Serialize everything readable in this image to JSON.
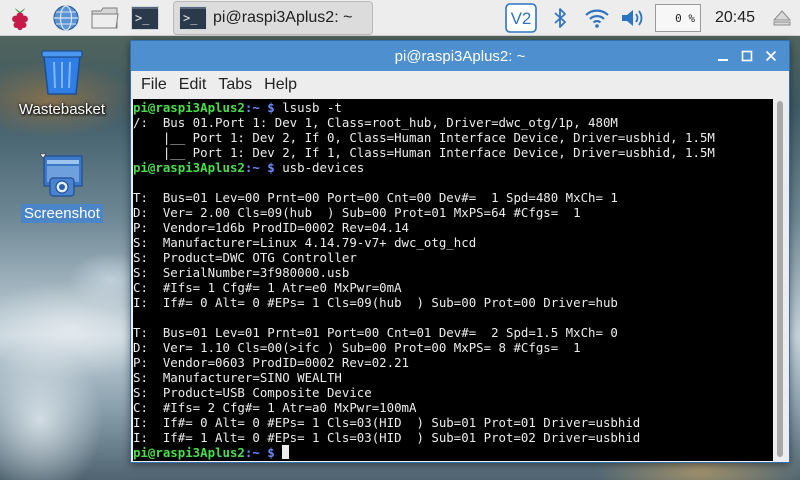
{
  "panel": {
    "launchers": [
      {
        "icon": "raspberry-menu-icon"
      },
      {
        "icon": "web-browser-icon"
      },
      {
        "icon": "file-manager-icon"
      },
      {
        "icon": "terminal-icon",
        "glyph": ">_"
      }
    ],
    "task": {
      "icon": "terminal-icon",
      "glyph": ">_",
      "label": "pi@raspi3Aplus2: ~"
    },
    "tray": {
      "vnc_label": "V2",
      "cpu_usage": "0 %",
      "clock": "20:45"
    }
  },
  "desktop": {
    "icons": [
      {
        "label": "Wastebasket",
        "icon": "wastebasket-icon"
      },
      {
        "label": "Screenshot",
        "icon": "screenshot-icon"
      }
    ]
  },
  "window": {
    "title": "pi@raspi3Aplus2: ~",
    "menu": [
      "File",
      "Edit",
      "Tabs",
      "Help"
    ]
  },
  "terminal": {
    "prompt_user": "pi@raspi3Aplus2",
    "prompt_path": ":~ $",
    "lines": [
      {
        "type": "prompt",
        "cmd": " lsusb -t"
      },
      {
        "type": "out",
        "text": "/:  Bus 01.Port 1: Dev 1, Class=root_hub, Driver=dwc_otg/1p, 480M"
      },
      {
        "type": "out",
        "text": "    |__ Port 1: Dev 2, If 0, Class=Human Interface Device, Driver=usbhid, 1.5M"
      },
      {
        "type": "out",
        "text": "    |__ Port 1: Dev 2, If 1, Class=Human Interface Device, Driver=usbhid, 1.5M"
      },
      {
        "type": "prompt",
        "cmd": " usb-devices"
      },
      {
        "type": "out",
        "text": ""
      },
      {
        "type": "out",
        "text": "T:  Bus=01 Lev=00 Prnt=00 Port=00 Cnt=00 Dev#=  1 Spd=480 MxCh= 1"
      },
      {
        "type": "out",
        "text": "D:  Ver= 2.00 Cls=09(hub  ) Sub=00 Prot=01 MxPS=64 #Cfgs=  1"
      },
      {
        "type": "out",
        "text": "P:  Vendor=1d6b ProdID=0002 Rev=04.14"
      },
      {
        "type": "out",
        "text": "S:  Manufacturer=Linux 4.14.79-v7+ dwc_otg_hcd"
      },
      {
        "type": "out",
        "text": "S:  Product=DWC OTG Controller"
      },
      {
        "type": "out",
        "text": "S:  SerialNumber=3f980000.usb"
      },
      {
        "type": "out",
        "text": "C:  #Ifs= 1 Cfg#= 1 Atr=e0 MxPwr=0mA"
      },
      {
        "type": "out",
        "text": "I:  If#= 0 Alt= 0 #EPs= 1 Cls=09(hub  ) Sub=00 Prot=00 Driver=hub"
      },
      {
        "type": "out",
        "text": ""
      },
      {
        "type": "out",
        "text": "T:  Bus=01 Lev=01 Prnt=01 Port=00 Cnt=01 Dev#=  2 Spd=1.5 MxCh= 0"
      },
      {
        "type": "out",
        "text": "D:  Ver= 1.10 Cls=00(>ifc ) Sub=00 Prot=00 MxPS= 8 #Cfgs=  1"
      },
      {
        "type": "out",
        "text": "P:  Vendor=0603 ProdID=0002 Rev=02.21"
      },
      {
        "type": "out",
        "text": "S:  Manufacturer=SINO WEALTH"
      },
      {
        "type": "out",
        "text": "S:  Product=USB Composite Device"
      },
      {
        "type": "out",
        "text": "C:  #Ifs= 2 Cfg#= 1 Atr=a0 MxPwr=100mA"
      },
      {
        "type": "out",
        "text": "I:  If#= 0 Alt= 0 #EPs= 1 Cls=03(HID  ) Sub=01 Prot=01 Driver=usbhid"
      },
      {
        "type": "out",
        "text": "I:  If#= 1 Alt= 0 #EPs= 1 Cls=03(HID  ) Sub=01 Prot=02 Driver=usbhid"
      },
      {
        "type": "prompt",
        "cmd": " ",
        "cursor": true
      }
    ]
  },
  "colors": {
    "titlebar": "#4d8fcf",
    "prompt_user": "#4ade4a",
    "prompt_path": "#6a8bff",
    "terminal_bg": "#000000",
    "selection": "#4a86c7"
  }
}
